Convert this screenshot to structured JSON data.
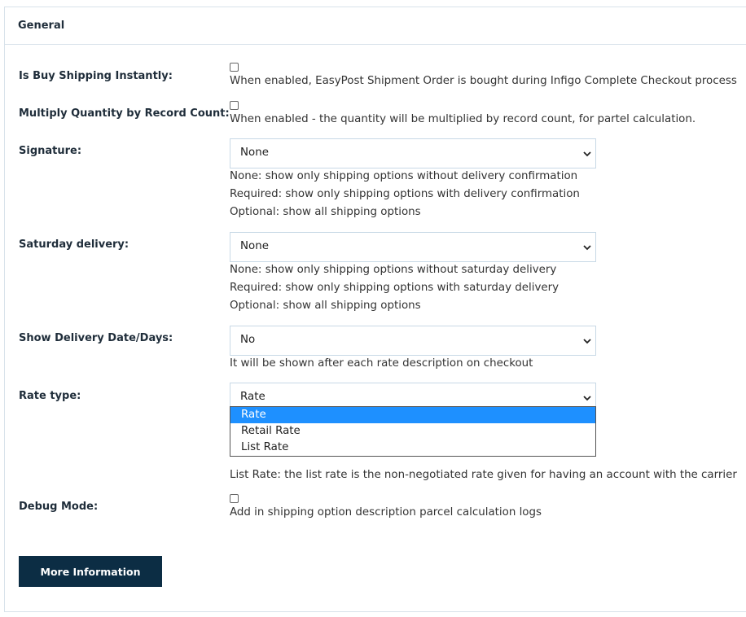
{
  "panel": {
    "title": "General"
  },
  "fields": {
    "buy_instantly": {
      "label": "Is Buy Shipping Instantly:",
      "checked": false,
      "hint": "When enabled, EasyPost Shipment Order is bought during Infigo Complete Checkout process"
    },
    "multiply_qty": {
      "label": "Multiply Quantity by Record Count:",
      "checked": false,
      "hint": "When enabled - the quantity will be multiplied by record count, for partel calculation."
    },
    "signature": {
      "label": "Signature:",
      "value": "None",
      "hints": [
        "None: show only shipping options without delivery confirmation",
        "Required: show only shipping options with delivery confirmation",
        "Optional: show all shipping options"
      ]
    },
    "saturday": {
      "label": "Saturday delivery:",
      "value": "None",
      "hints": [
        "None: show only shipping options without saturday delivery",
        "Required: show only shipping options with saturday delivery",
        "Optional: show all shipping options"
      ]
    },
    "delivery_date": {
      "label": "Show Delivery Date/Days:",
      "value": "No",
      "hint": "It will be shown after each rate description on checkout"
    },
    "rate_type": {
      "label": "Rate type:",
      "value": "Rate",
      "options": [
        "Rate",
        "Retail Rate",
        "List Rate"
      ],
      "selected_index": 0,
      "hint_visible": "List Rate: the list rate is the non-negotiated rate given for having an account with the carrier"
    },
    "debug": {
      "label": "Debug Mode:",
      "checked": false,
      "hint": "Add in shipping option description parcel calculation logs"
    }
  },
  "more_info_button": "More Information",
  "icons": {
    "select_arrow": "chevron-down-icon"
  },
  "colors": {
    "accent": "#1e90ff",
    "button_bg": "#0c2d44",
    "border": "#d8e2ea"
  }
}
